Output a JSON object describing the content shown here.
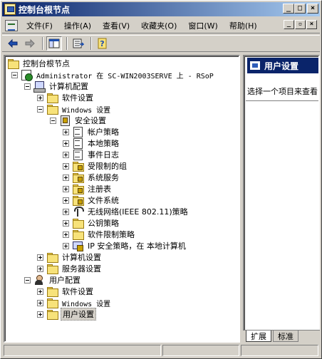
{
  "window": {
    "title": "控制台根节点",
    "buttons": {
      "minimize": "_",
      "maximize": "□",
      "close": "×"
    }
  },
  "menubar": {
    "items": [
      "文件(F)",
      "操作(A)",
      "查看(V)",
      "收藏夹(O)",
      "窗口(W)",
      "帮助(H)"
    ],
    "inner_buttons": {
      "minimize": "_",
      "restore": "▫",
      "close": "×"
    }
  },
  "toolbar": {
    "buttons": [
      "back-icon",
      "forward-icon",
      "show-tree-icon",
      "export-list-icon",
      "help-icon"
    ]
  },
  "tree": {
    "root": "控制台根节点",
    "rsop": "Administrator 在 SC-WIN2003SERVE 上 - RSoP",
    "computer_config": "计算机配置",
    "software_settings": "软件设置",
    "windows_settings": "Windows 设置",
    "security_settings": "安全设置",
    "account_policies": "帐户策略",
    "local_policies": "本地策略",
    "event_log": "事件日志",
    "restricted_groups": "受限制的组",
    "system_services": "系统服务",
    "registry": "注册表",
    "file_system": "文件系统",
    "wireless_policy": "无线网络(IEEE 802.11)策略",
    "public_key_policies": "公钥策略",
    "software_restriction": "软件限制策略",
    "ip_security": "IP 安全策略，在 本地计算机",
    "admin_templates_computer": "计算机设置",
    "server_settings": "服务器设置",
    "user_config": "用户配置",
    "user_software_settings": "软件设置",
    "user_windows_settings": "Windows 设置",
    "user_settings": "用户设置"
  },
  "right_pane": {
    "header": "用户设置",
    "description": "选择一个项目来查看"
  },
  "tabs": {
    "extended": "扩展",
    "standard": "标准"
  },
  "colors": {
    "title_bar": "#0a246a",
    "face": "#d4d0c8",
    "header_bg": "#0a246a"
  }
}
